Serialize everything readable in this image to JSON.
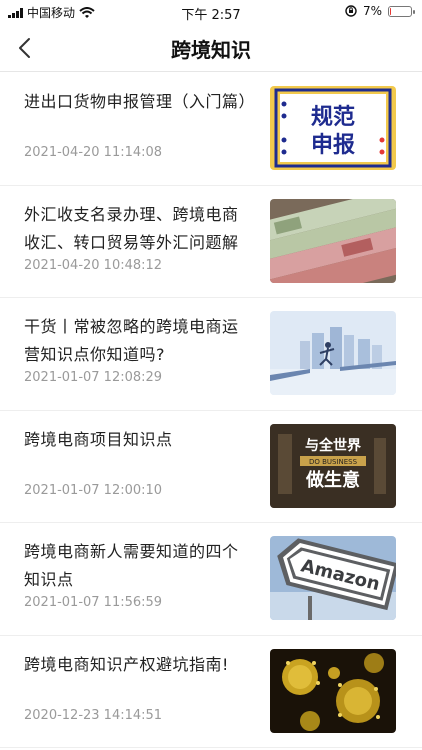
{
  "status_bar": {
    "carrier": "中国移动",
    "time": "下午 2:57",
    "battery": "7%",
    "battery_level": 0.07
  },
  "nav": {
    "title": "跨境知识",
    "back_icon": "chevron-left-icon"
  },
  "articles": [
    {
      "title": "进出口货物申报管理（入门篇）",
      "date": "2021-04-20 11:14:08",
      "thumb_line1": "规范",
      "thumb_line2": "申报"
    },
    {
      "title": "外汇收支名录办理、跨境电商收汇、转口贸易等外汇问题解",
      "date": "2021-04-20 10:48:12"
    },
    {
      "title": "干货丨常被忽略的跨境电商运营知识点你知道吗?",
      "date": "2021-01-07 12:08:29"
    },
    {
      "title": "跨境电商项目知识点",
      "date": "2021-01-07 12:00:10",
      "thumb_line1": "与全世界",
      "thumb_line2": "DO BUSINESS",
      "thumb_line3": "做生意"
    },
    {
      "title": "跨境电商新人需要知道的四个知识点",
      "date": "2021-01-07 11:56:59",
      "thumb_line1": "Amazon"
    },
    {
      "title": "跨境电商知识产权避坑指南!",
      "date": "2020-12-23 14:14:51"
    }
  ],
  "colors": {
    "title_text": "#222222",
    "date_text": "#9a9a9a",
    "divider": "#eeeeee"
  }
}
